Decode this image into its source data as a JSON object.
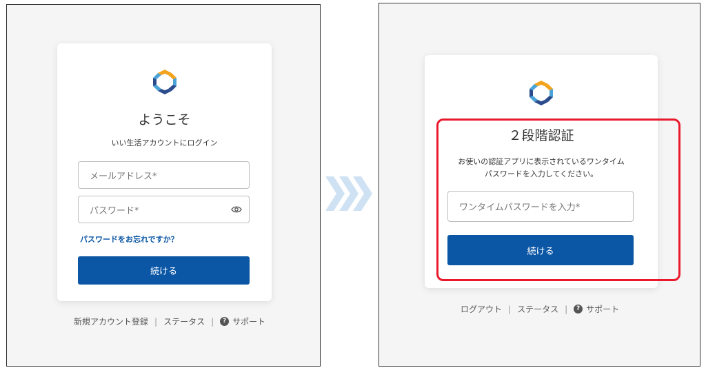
{
  "left": {
    "title": "ようこそ",
    "subtitle": "いい生活アカウントにログイン",
    "email_placeholder": "メールアドレス*",
    "password_placeholder": "パスワード*",
    "forgot_link": "パスワードをお忘れですか？",
    "continue_label": "続ける",
    "footer": {
      "register": "新規アカウント登録",
      "status": "ステータス",
      "support": "サポート"
    }
  },
  "right": {
    "title": "２段階認証",
    "description_line1": "お使いの認証アプリに表示されているワンタイム",
    "description_line2": "パスワードを入力してください。",
    "otp_placeholder": "ワンタイムパスワードを入力*",
    "continue_label": "続ける",
    "footer": {
      "logout": "ログアウト",
      "status": "ステータス",
      "support": "サポート"
    }
  },
  "separator": "|",
  "help_glyph": "?",
  "icons": {
    "logo": "hexagon-logo-icon",
    "eye": "eye-icon",
    "help": "help-circle-icon",
    "arrow": "chevron-arrows-icon"
  },
  "colors": {
    "accent": "#0b57a6",
    "highlight": "#e8192c",
    "logo_blue": "#2b4b8c",
    "logo_sky": "#4aa3d8",
    "logo_orange": "#f3a21b"
  }
}
